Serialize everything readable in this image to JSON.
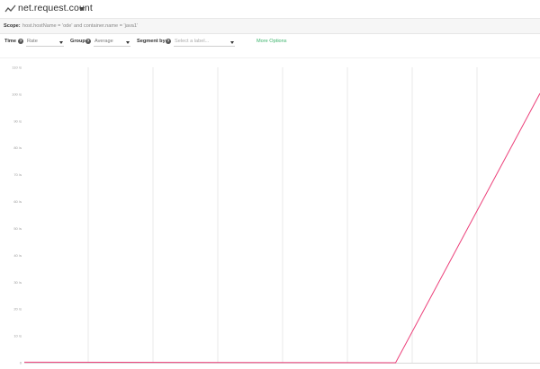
{
  "header": {
    "title": "net.request.count",
    "icon": "line-chart-icon"
  },
  "scope": {
    "label": "Scope:",
    "value": "host.hostName = 'ode' and container.name = 'java1'"
  },
  "controls": {
    "time": {
      "label": "Time",
      "value": "Rate"
    },
    "group": {
      "label": "Group",
      "value": "Average"
    },
    "segment": {
      "label": "Segment by",
      "placeholder": "Select a label..."
    },
    "more_options": "More Options"
  },
  "colors": {
    "series": "#ec407a",
    "link": "#3bb36b",
    "grid": "#e4e4e4"
  },
  "chart_data": {
    "type": "line",
    "ylim": [
      0,
      110
    ],
    "yticks": [
      {
        "value": 0,
        "label": "0"
      },
      {
        "value": 10,
        "label": "10 /s"
      },
      {
        "value": 20,
        "label": "20 /s"
      },
      {
        "value": 30,
        "label": "30 /s"
      },
      {
        "value": 40,
        "label": "40 /s"
      },
      {
        "value": 50,
        "label": "50 /s"
      },
      {
        "value": 60,
        "label": "60 /s"
      },
      {
        "value": 70,
        "label": "70 /s"
      },
      {
        "value": 80,
        "label": "80 /s"
      },
      {
        "value": 90,
        "label": "90 /s"
      },
      {
        "value": 100,
        "label": "100 /s"
      },
      {
        "value": 110,
        "label": "110 /s"
      }
    ],
    "xlim": [
      0,
      100
    ],
    "series": [
      {
        "x": [
          0,
          72,
          100
        ],
        "y": [
          0.2,
          0,
          100.3
        ]
      }
    ]
  }
}
